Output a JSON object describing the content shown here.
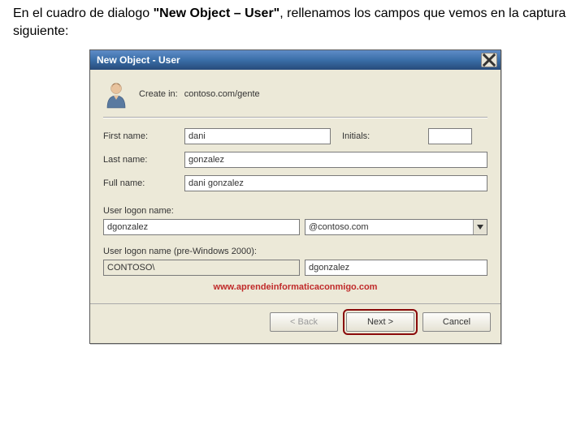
{
  "intro": {
    "pre": "En el cuadro de dialogo ",
    "bold": "\"New Object – User\"",
    "post": ", rellenamos los campos que vemos en la captura siguiente:"
  },
  "titlebar": {
    "title": "New Object - User"
  },
  "create_in": {
    "label": "Create in:",
    "path": "contoso.com/gente"
  },
  "fields": {
    "first_name_label": "First name:",
    "first_name_value": "dani",
    "initials_label": "Initials:",
    "initials_value": "",
    "last_name_label": "Last name:",
    "last_name_value": "gonzalez",
    "full_name_label": "Full name:",
    "full_name_value": "dani gonzalez",
    "logon_name_label": "User logon name:",
    "logon_user_value": "dgonzalez",
    "domain_suffix": "@contoso.com",
    "logon_pre_label": "User logon name (pre-Windows 2000):",
    "domain_prefix": "CONTOSO\\",
    "logon_pre_value": "dgonzalez"
  },
  "watermark": "www.aprendeinformaticaconmigo.com",
  "buttons": {
    "back": "< Back",
    "next": "Next >",
    "cancel": "Cancel"
  }
}
